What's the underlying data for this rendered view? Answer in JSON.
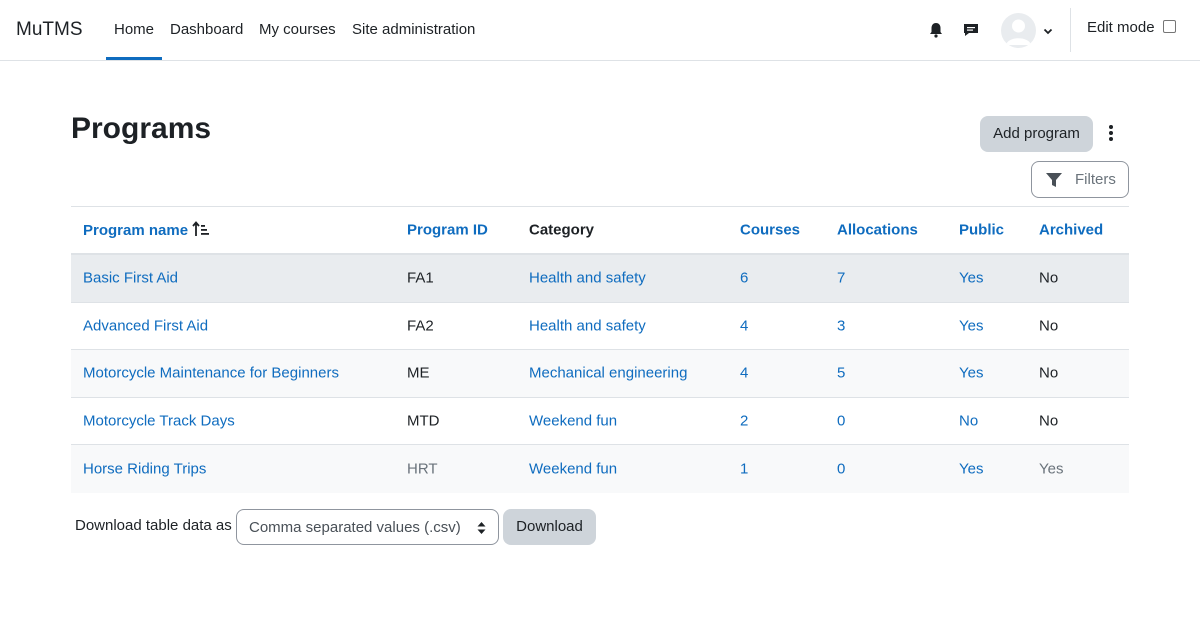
{
  "brand": "MuTMS",
  "nav": {
    "items": [
      "Home",
      "Dashboard",
      "My courses",
      "Site administration"
    ],
    "active": "Home",
    "edit_mode_label": "Edit mode"
  },
  "page": {
    "title": "Programs",
    "add_button": "Add program",
    "filters_button": "Filters"
  },
  "table": {
    "headers": [
      "Program name",
      "Program ID",
      "Category",
      "Courses",
      "Allocations",
      "Public",
      "Archived"
    ],
    "rows": [
      {
        "name": "Basic First Aid",
        "id": "FA1",
        "category": "Health and safety",
        "courses": "6",
        "allocations": "7",
        "public": "Yes",
        "archived": "No"
      },
      {
        "name": "Advanced First Aid",
        "id": "FA2",
        "category": "Health and safety",
        "courses": "4",
        "allocations": "3",
        "public": "Yes",
        "archived": "No"
      },
      {
        "name": "Motorcycle Maintenance for Beginners",
        "id": "ME",
        "category": "Mechanical engineering",
        "courses": "4",
        "allocations": "5",
        "public": "Yes",
        "archived": "No"
      },
      {
        "name": "Motorcycle Track Days",
        "id": "MTD",
        "category": "Weekend fun",
        "courses": "2",
        "allocations": "0",
        "public": "No",
        "archived": "No"
      },
      {
        "name": "Horse Riding Trips",
        "id": "HRT",
        "category": "Weekend fun",
        "courses": "1",
        "allocations": "0",
        "public": "Yes",
        "archived": "Yes"
      }
    ]
  },
  "download": {
    "label": "Download table data as",
    "format": "Comma separated values (.csv)",
    "button": "Download"
  },
  "colors": {
    "link": "#0f6cbf",
    "button_secondary": "#ced4da",
    "muted": "#6a737b"
  }
}
